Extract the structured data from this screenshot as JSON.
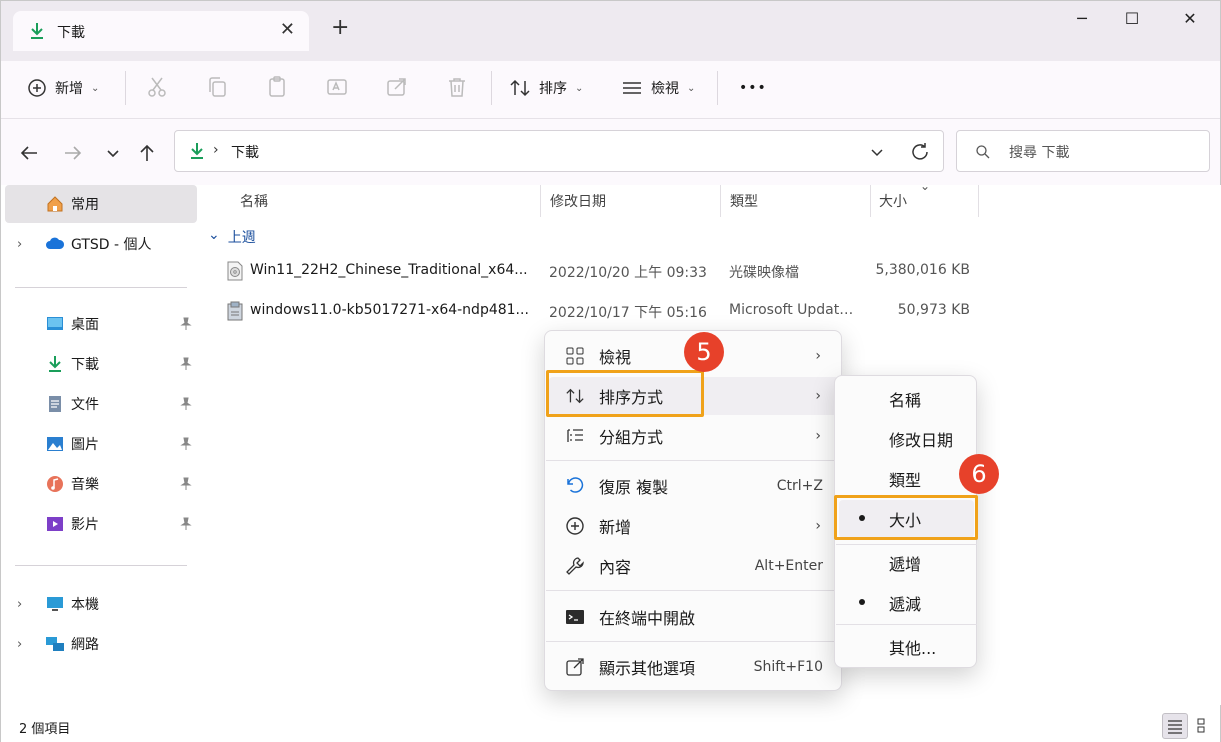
{
  "window": {
    "tab_title": "下載",
    "tab_close": "✕",
    "new_tab": "+",
    "minimize": "─",
    "maximize": "☐",
    "close": "✕"
  },
  "commandbar": {
    "new_label": "新增",
    "sort_label": "排序",
    "view_label": "檢視",
    "more_label": "•••"
  },
  "address": {
    "crumb": "下載",
    "search_placeholder": "搜尋 下載"
  },
  "sidebar": {
    "items": [
      {
        "label": "常用"
      },
      {
        "label": "GTSD - 個人"
      },
      {
        "label": "桌面"
      },
      {
        "label": "下載"
      },
      {
        "label": "文件"
      },
      {
        "label": "圖片"
      },
      {
        "label": "音樂"
      },
      {
        "label": "影片"
      },
      {
        "label": "本機"
      },
      {
        "label": "網路"
      }
    ]
  },
  "columns": {
    "name": "名稱",
    "date": "修改日期",
    "type": "類型",
    "size": "大小"
  },
  "group": {
    "label": "上週"
  },
  "files": [
    {
      "name": "Win11_22H2_Chinese_Traditional_x64...",
      "date": "2022/10/20 上午 09:33",
      "type": "光碟映像檔",
      "size": "5,380,016 KB"
    },
    {
      "name": "windows11.0-kb5017271-x64-ndp481...",
      "date": "2022/10/17 下午 05:16",
      "type": "Microsoft Update...",
      "size": "50,973 KB"
    }
  ],
  "status": {
    "count": "2 個項目"
  },
  "context_menu": {
    "view": "檢視",
    "sort_by": "排序方式",
    "group_by": "分組方式",
    "undo": "復原 複製",
    "undo_key": "Ctrl+Z",
    "new": "新增",
    "properties": "內容",
    "properties_key": "Alt+Enter",
    "terminal": "在終端中開啟",
    "more_options": "顯示其他選項",
    "more_options_key": "Shift+F10",
    "submenu_arrow": "›"
  },
  "sort_submenu": {
    "name": "名稱",
    "date": "修改日期",
    "type": "類型",
    "size": "大小",
    "ascending": "遞增",
    "descending": "遞減",
    "more": "其他..."
  },
  "annotations": {
    "step5": "5",
    "step6": "6",
    "highlight_color": "#f0a21a",
    "badge_color": "#e7412a"
  }
}
